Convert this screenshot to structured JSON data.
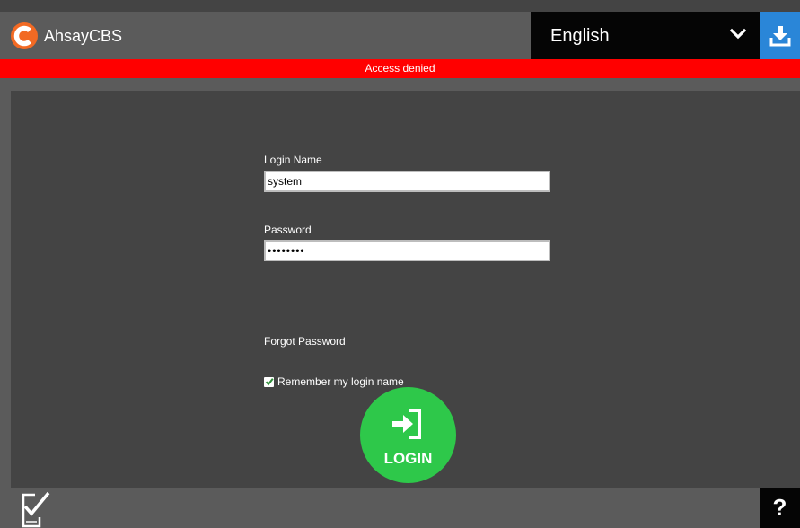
{
  "app": {
    "title": "AhsayCBS",
    "logo_icon": "ahsay-logo-icon",
    "brand_color": "#f26a24"
  },
  "header": {
    "language": "English",
    "language_icon": "chevron-down-icon",
    "download_icon": "download-icon",
    "download_color": "#2a86d8"
  },
  "alert": {
    "message": "Access denied",
    "color": "#ff0000"
  },
  "form": {
    "login_label": "Login Name",
    "login_value": "system",
    "password_label": "Password",
    "password_value": "••••••••",
    "forgot_label": "Forgot Password",
    "remember_label": "Remember my login name",
    "remember_checked": true
  },
  "login_button": {
    "label": "LOGIN",
    "icon": "sign-in-icon",
    "color": "#2ec84a"
  },
  "footer": {
    "checklist_icon": "device-checklist-icon",
    "help_label": "?"
  }
}
